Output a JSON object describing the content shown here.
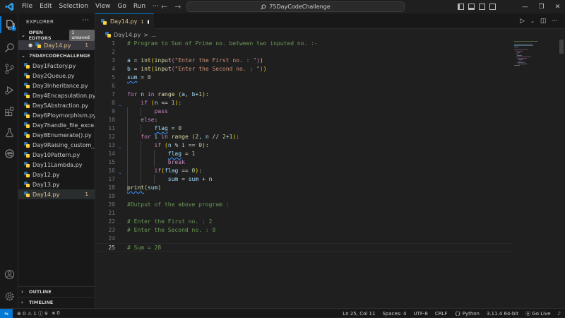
{
  "titlebar": {
    "menu": [
      "File",
      "Edit",
      "Selection",
      "View",
      "Go",
      "Run",
      "···"
    ],
    "search": "75DayCodeChallenge"
  },
  "sidebar": {
    "title": "EXPLORER",
    "open_editors_label": "OPEN EDITORS",
    "unsaved_badge": "1 unsaved",
    "open_file": "Day14.py",
    "open_file_count": "1",
    "folder_name": "75DAYCODECHALLENGE",
    "files": [
      {
        "name": "Day1Factory.py",
        "count": ""
      },
      {
        "name": "Day2Queue.py",
        "count": ""
      },
      {
        "name": "Day3Inheritance.py",
        "count": ""
      },
      {
        "name": "Day4Encapsulation.py",
        "count": ""
      },
      {
        "name": "Day5Abstraction.py",
        "count": ""
      },
      {
        "name": "Day6Ploymorphism.py",
        "count": ""
      },
      {
        "name": "Day7handle_file_exce...",
        "count": ""
      },
      {
        "name": "Day8Enumerate().py",
        "count": ""
      },
      {
        "name": "Day9Raising_custom_...",
        "count": ""
      },
      {
        "name": "Day10Pattern.py",
        "count": ""
      },
      {
        "name": "Day11Lambda.py",
        "count": ""
      },
      {
        "name": "Day12.py",
        "count": ""
      },
      {
        "name": "Day13.py",
        "count": ""
      },
      {
        "name": "Day14.py",
        "count": "1"
      }
    ],
    "outline_label": "OUTLINE",
    "timeline_label": "TIMELINE"
  },
  "tab": {
    "label": "Day14.py",
    "count": "1"
  },
  "breadcrumb": {
    "file": "Day14.py",
    "sep": ">",
    "rest": "..."
  },
  "editor": {
    "line_numbers": [
      "1",
      "2",
      "3",
      "4",
      "5",
      "6",
      "7",
      "8",
      "9",
      "10",
      "11",
      "12",
      "13",
      "14",
      "15",
      "16",
      "17",
      "18",
      "19",
      "20",
      "21",
      "22",
      "23",
      "24",
      "25"
    ],
    "current_line": 25
  },
  "statusbar": {
    "problems": "⊗ 0 ⚠ 1 ⓘ 9",
    "ports": "⨳ 0",
    "position": "Ln 25, Col 11",
    "spaces": "Spaces: 4",
    "encoding": "UTF-8",
    "eol": "CRLF",
    "language": "Python",
    "interpreter": "3.11.4 64-bit",
    "golive": "Go Live"
  },
  "colors": {
    "accent": "#0078d4",
    "modified": "#e2c08d",
    "keyword": "#c586c0",
    "function": "#dcdcaa",
    "variable": "#9cdcfe",
    "number": "#b5cea8",
    "string": "#ce9178",
    "comment": "#6a9955"
  }
}
